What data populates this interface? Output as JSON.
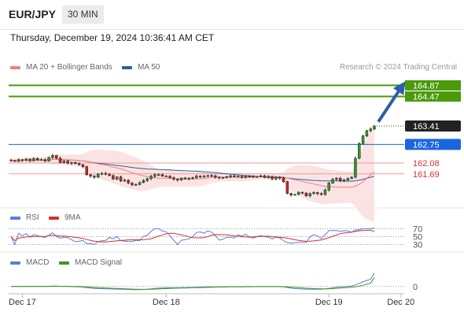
{
  "header": {
    "symbol": "EUR/JPY",
    "interval": "30 MIN"
  },
  "timestamp": "Thursday, December 19, 2024 10:36:41 AM CET",
  "legend": {
    "main": [
      {
        "label": "MA 20 + Bollinger Bands",
        "color": "#f08080"
      },
      {
        "label": "MA 50",
        "color": "#2c5f9e"
      }
    ],
    "rsi": [
      {
        "label": "RSI",
        "color": "#5b7fd6"
      },
      {
        "label": "9MA",
        "color": "#d32f2f"
      }
    ],
    "macd": [
      {
        "label": "MACD",
        "color": "#5b7fd6"
      },
      {
        "label": "MACD Signal",
        "color": "#3a9a1a"
      }
    ]
  },
  "credit": "Research © 2024 Trading Central",
  "chart_data": {
    "type": "candlestick",
    "price_ylim": [
      160.58,
      165.25
    ],
    "levels": [
      {
        "value": 164.87,
        "label": "164.87",
        "kind": "target",
        "color": "#4a9a0a"
      },
      {
        "value": 164.47,
        "label": "164.47",
        "kind": "target",
        "color": "#4a9a0a"
      },
      {
        "value": 163.41,
        "label": "163.41",
        "kind": "last-price",
        "color": "#222222"
      },
      {
        "value": 162.75,
        "label": "162.75",
        "kind": "pivot",
        "color": "#1a66e0"
      },
      {
        "value": 162.08,
        "label": "162.08",
        "kind": "support",
        "color": "#e03030"
      },
      {
        "value": 161.69,
        "label": "161.69",
        "kind": "support",
        "color": "#e03030"
      }
    ],
    "x_labels": [
      "Dec 17",
      "Dec 18",
      "Dec 19",
      "Dec 20"
    ],
    "x_label_index": [
      3,
      41,
      84,
      103
    ],
    "closes": [
      162.17,
      162.15,
      162.2,
      162.18,
      162.22,
      162.16,
      162.24,
      162.19,
      162.2,
      162.15,
      162.28,
      162.35,
      162.25,
      162.1,
      162.15,
      162.07,
      162.1,
      162.06,
      162.02,
      161.95,
      161.66,
      161.61,
      161.57,
      161.68,
      161.71,
      161.68,
      161.63,
      161.5,
      161.58,
      161.44,
      161.46,
      161.36,
      161.3,
      161.31,
      161.38,
      161.45,
      161.52,
      161.6,
      161.66,
      161.66,
      161.61,
      161.61,
      161.55,
      161.5,
      161.47,
      161.54,
      161.52,
      161.54,
      161.55,
      161.61,
      161.59,
      161.6,
      161.63,
      161.62,
      161.57,
      161.55,
      161.55,
      161.59,
      161.62,
      161.59,
      161.6,
      161.56,
      161.61,
      161.58,
      161.59,
      161.59,
      161.62,
      161.56,
      161.6,
      161.51,
      161.57,
      161.54,
      161.41,
      160.99,
      160.93,
      160.95,
      161.03,
      161.0,
      160.9,
      160.98,
      161.02,
      160.98,
      160.95,
      161.11,
      161.36,
      161.49,
      161.53,
      161.45,
      161.47,
      161.52,
      161.57,
      162.25,
      162.78,
      163.05,
      163.24,
      163.3,
      163.41
    ],
    "ma20_end": 161.97,
    "ma50_end": 161.55,
    "rsi": {
      "ylim": [
        15,
        85
      ],
      "levels": [
        70,
        50,
        30
      ],
      "last_rsi": 72,
      "last_ma": 63
    },
    "macd": {
      "level": 0,
      "last_macd": 0.82,
      "last_signal": 0.55
    }
  }
}
